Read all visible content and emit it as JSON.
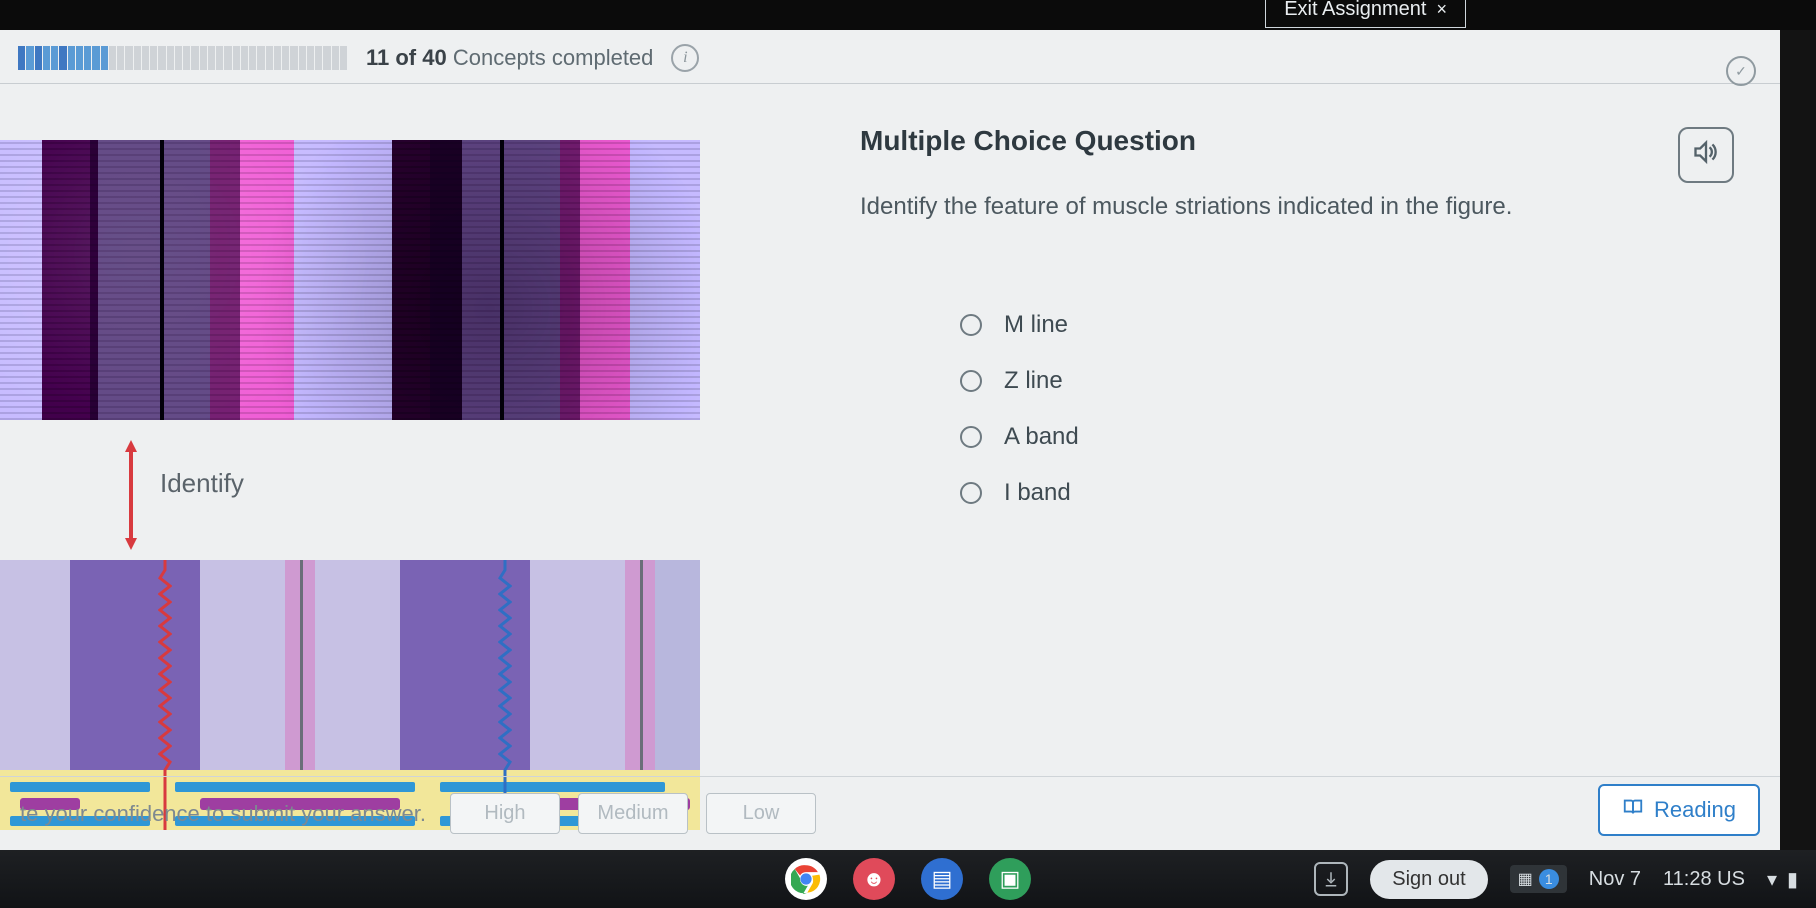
{
  "topbar": {
    "exit_label": "Exit Assignment",
    "exit_symbol": "×"
  },
  "progress": {
    "completed": 11,
    "total": 40,
    "status_prefix": "11 of 40",
    "status_suffix": "Concepts completed"
  },
  "figure": {
    "identify_label": "Identify"
  },
  "question": {
    "heading": "Multiple Choice Question",
    "prompt": "Identify the feature of muscle striations indicated in the figure.",
    "options": [
      {
        "label": "M line"
      },
      {
        "label": "Z line"
      },
      {
        "label": "A band"
      },
      {
        "label": "I band"
      }
    ]
  },
  "confidence": {
    "prompt": "te your confidence to submit your answer.",
    "buttons": {
      "high": "High",
      "medium": "Medium",
      "low": "Low"
    }
  },
  "reading": {
    "label": "Reading"
  },
  "taskbar": {
    "signout": "Sign out",
    "date": "Nov 7",
    "clock": "11:28",
    "locale": "US",
    "badge": "1"
  }
}
